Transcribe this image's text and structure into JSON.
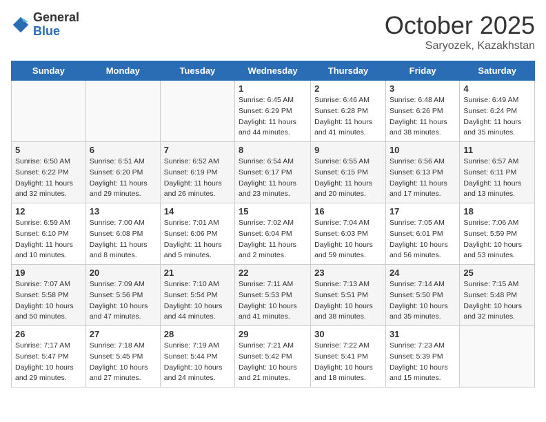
{
  "logo": {
    "general": "General",
    "blue": "Blue"
  },
  "header": {
    "month": "October 2025",
    "location": "Saryozek, Kazakhstan"
  },
  "weekdays": [
    "Sunday",
    "Monday",
    "Tuesday",
    "Wednesday",
    "Thursday",
    "Friday",
    "Saturday"
  ],
  "weeks": [
    [
      {
        "day": "",
        "sunrise": "",
        "sunset": "",
        "daylight": ""
      },
      {
        "day": "",
        "sunrise": "",
        "sunset": "",
        "daylight": ""
      },
      {
        "day": "",
        "sunrise": "",
        "sunset": "",
        "daylight": ""
      },
      {
        "day": "1",
        "sunrise": "Sunrise: 6:45 AM",
        "sunset": "Sunset: 6:29 PM",
        "daylight": "Daylight: 11 hours and 44 minutes."
      },
      {
        "day": "2",
        "sunrise": "Sunrise: 6:46 AM",
        "sunset": "Sunset: 6:28 PM",
        "daylight": "Daylight: 11 hours and 41 minutes."
      },
      {
        "day": "3",
        "sunrise": "Sunrise: 6:48 AM",
        "sunset": "Sunset: 6:26 PM",
        "daylight": "Daylight: 11 hours and 38 minutes."
      },
      {
        "day": "4",
        "sunrise": "Sunrise: 6:49 AM",
        "sunset": "Sunset: 6:24 PM",
        "daylight": "Daylight: 11 hours and 35 minutes."
      }
    ],
    [
      {
        "day": "5",
        "sunrise": "Sunrise: 6:50 AM",
        "sunset": "Sunset: 6:22 PM",
        "daylight": "Daylight: 11 hours and 32 minutes."
      },
      {
        "day": "6",
        "sunrise": "Sunrise: 6:51 AM",
        "sunset": "Sunset: 6:20 PM",
        "daylight": "Daylight: 11 hours and 29 minutes."
      },
      {
        "day": "7",
        "sunrise": "Sunrise: 6:52 AM",
        "sunset": "Sunset: 6:19 PM",
        "daylight": "Daylight: 11 hours and 26 minutes."
      },
      {
        "day": "8",
        "sunrise": "Sunrise: 6:54 AM",
        "sunset": "Sunset: 6:17 PM",
        "daylight": "Daylight: 11 hours and 23 minutes."
      },
      {
        "day": "9",
        "sunrise": "Sunrise: 6:55 AM",
        "sunset": "Sunset: 6:15 PM",
        "daylight": "Daylight: 11 hours and 20 minutes."
      },
      {
        "day": "10",
        "sunrise": "Sunrise: 6:56 AM",
        "sunset": "Sunset: 6:13 PM",
        "daylight": "Daylight: 11 hours and 17 minutes."
      },
      {
        "day": "11",
        "sunrise": "Sunrise: 6:57 AM",
        "sunset": "Sunset: 6:11 PM",
        "daylight": "Daylight: 11 hours and 13 minutes."
      }
    ],
    [
      {
        "day": "12",
        "sunrise": "Sunrise: 6:59 AM",
        "sunset": "Sunset: 6:10 PM",
        "daylight": "Daylight: 11 hours and 10 minutes."
      },
      {
        "day": "13",
        "sunrise": "Sunrise: 7:00 AM",
        "sunset": "Sunset: 6:08 PM",
        "daylight": "Daylight: 11 hours and 8 minutes."
      },
      {
        "day": "14",
        "sunrise": "Sunrise: 7:01 AM",
        "sunset": "Sunset: 6:06 PM",
        "daylight": "Daylight: 11 hours and 5 minutes."
      },
      {
        "day": "15",
        "sunrise": "Sunrise: 7:02 AM",
        "sunset": "Sunset: 6:04 PM",
        "daylight": "Daylight: 11 hours and 2 minutes."
      },
      {
        "day": "16",
        "sunrise": "Sunrise: 7:04 AM",
        "sunset": "Sunset: 6:03 PM",
        "daylight": "Daylight: 10 hours and 59 minutes."
      },
      {
        "day": "17",
        "sunrise": "Sunrise: 7:05 AM",
        "sunset": "Sunset: 6:01 PM",
        "daylight": "Daylight: 10 hours and 56 minutes."
      },
      {
        "day": "18",
        "sunrise": "Sunrise: 7:06 AM",
        "sunset": "Sunset: 5:59 PM",
        "daylight": "Daylight: 10 hours and 53 minutes."
      }
    ],
    [
      {
        "day": "19",
        "sunrise": "Sunrise: 7:07 AM",
        "sunset": "Sunset: 5:58 PM",
        "daylight": "Daylight: 10 hours and 50 minutes."
      },
      {
        "day": "20",
        "sunrise": "Sunrise: 7:09 AM",
        "sunset": "Sunset: 5:56 PM",
        "daylight": "Daylight: 10 hours and 47 minutes."
      },
      {
        "day": "21",
        "sunrise": "Sunrise: 7:10 AM",
        "sunset": "Sunset: 5:54 PM",
        "daylight": "Daylight: 10 hours and 44 minutes."
      },
      {
        "day": "22",
        "sunrise": "Sunrise: 7:11 AM",
        "sunset": "Sunset: 5:53 PM",
        "daylight": "Daylight: 10 hours and 41 minutes."
      },
      {
        "day": "23",
        "sunrise": "Sunrise: 7:13 AM",
        "sunset": "Sunset: 5:51 PM",
        "daylight": "Daylight: 10 hours and 38 minutes."
      },
      {
        "day": "24",
        "sunrise": "Sunrise: 7:14 AM",
        "sunset": "Sunset: 5:50 PM",
        "daylight": "Daylight: 10 hours and 35 minutes."
      },
      {
        "day": "25",
        "sunrise": "Sunrise: 7:15 AM",
        "sunset": "Sunset: 5:48 PM",
        "daylight": "Daylight: 10 hours and 32 minutes."
      }
    ],
    [
      {
        "day": "26",
        "sunrise": "Sunrise: 7:17 AM",
        "sunset": "Sunset: 5:47 PM",
        "daylight": "Daylight: 10 hours and 29 minutes."
      },
      {
        "day": "27",
        "sunrise": "Sunrise: 7:18 AM",
        "sunset": "Sunset: 5:45 PM",
        "daylight": "Daylight: 10 hours and 27 minutes."
      },
      {
        "day": "28",
        "sunrise": "Sunrise: 7:19 AM",
        "sunset": "Sunset: 5:44 PM",
        "daylight": "Daylight: 10 hours and 24 minutes."
      },
      {
        "day": "29",
        "sunrise": "Sunrise: 7:21 AM",
        "sunset": "Sunset: 5:42 PM",
        "daylight": "Daylight: 10 hours and 21 minutes."
      },
      {
        "day": "30",
        "sunrise": "Sunrise: 7:22 AM",
        "sunset": "Sunset: 5:41 PM",
        "daylight": "Daylight: 10 hours and 18 minutes."
      },
      {
        "day": "31",
        "sunrise": "Sunrise: 7:23 AM",
        "sunset": "Sunset: 5:39 PM",
        "daylight": "Daylight: 10 hours and 15 minutes."
      },
      {
        "day": "",
        "sunrise": "",
        "sunset": "",
        "daylight": ""
      }
    ]
  ]
}
